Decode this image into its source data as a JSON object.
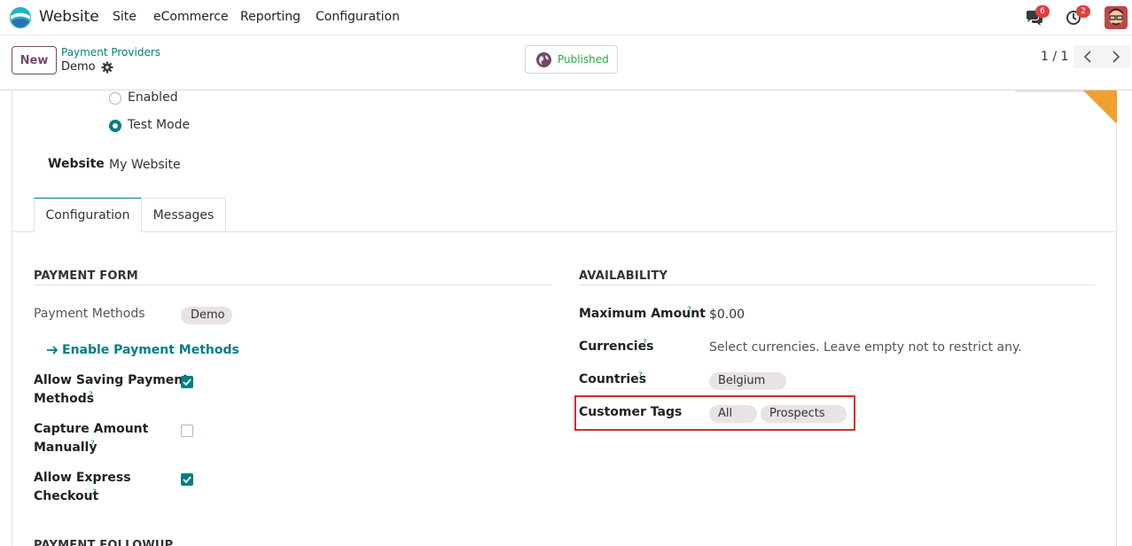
{
  "topnav": {
    "app_name": "Website",
    "menu": [
      "Site",
      "eCommerce",
      "Reporting",
      "Configuration"
    ],
    "messages_count": "6",
    "activities_count": "2"
  },
  "control_panel": {
    "new_label": "New",
    "breadcrumb_parent": "Payment Providers",
    "breadcrumb_current": "Demo",
    "published_label": "Published",
    "pager": "1 / 1"
  },
  "state": {
    "options": [
      "Enabled",
      "Test Mode"
    ],
    "selected": "Test Mode"
  },
  "website": {
    "label": "Website",
    "value": "My Website"
  },
  "tabs": [
    "Configuration",
    "Messages"
  ],
  "payment_form": {
    "title": "PAYMENT FORM",
    "payment_methods_label": "Payment Methods",
    "payment_methods_tag": "Demo",
    "enable_link": "Enable Payment Methods",
    "allow_saving_label_1": "Allow Saving Payment",
    "allow_saving_label_2": "Methods",
    "allow_saving_checked": true,
    "capture_label_1": "Capture Amount",
    "capture_label_2": "Manually",
    "capture_checked": false,
    "express_label_1": "Allow Express",
    "express_label_2": "Checkout",
    "express_checked": true,
    "next_section_title": "PAYMENT FOLLOWUP"
  },
  "availability": {
    "title": "AVAILABILITY",
    "max_amount_label": "Maximum Amount",
    "max_amount_value": "$0.00",
    "currencies_label": "Currencies",
    "currencies_placeholder": "Select currencies. Leave empty not to restrict any.",
    "countries_label": "Countries",
    "countries_tags": [
      "Belgium"
    ],
    "customer_tags_label": "Customer Tags",
    "customer_tags": [
      "All",
      "Prospects"
    ]
  },
  "help_marker": "?",
  "colors": {
    "accent": "#017e84",
    "brand": "#714b67",
    "highlight": "#d92b2b",
    "published": "#28a745"
  }
}
